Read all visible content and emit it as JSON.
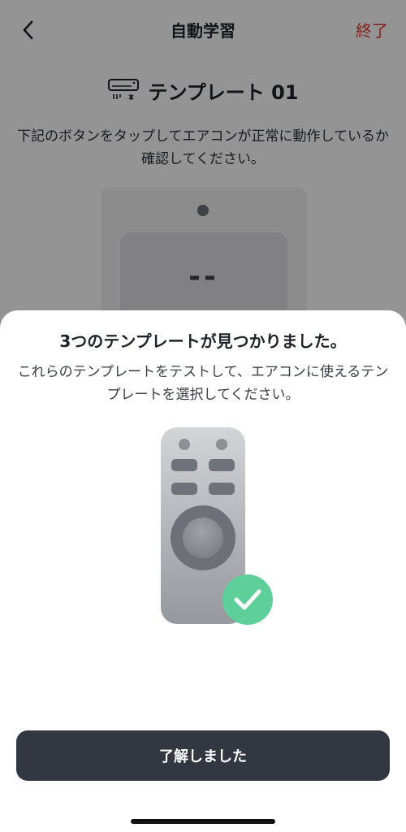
{
  "nav": {
    "title": "自動学習",
    "done_label": "終了"
  },
  "template": {
    "name": "テンプレート 01"
  },
  "instruction": "下記のボタンをタップしてエアコンが正常に動作しているか確認してください。",
  "remote_display": "--",
  "sheet": {
    "title": "3つのテンプレートが見つかりました。",
    "description": "これらのテンプレートをテストして、エアコンに使えるテンプレートを選択してください。",
    "confirm_label": "了解しました"
  },
  "icons": {
    "back": "chevron-left-icon",
    "ac": "air-conditioner-icon",
    "remote": "remote-control-illustration",
    "check": "checkmark-icon"
  },
  "colors": {
    "accent_red": "#e0392f",
    "check_green": "#5fcf99",
    "button_dark": "#333741"
  }
}
